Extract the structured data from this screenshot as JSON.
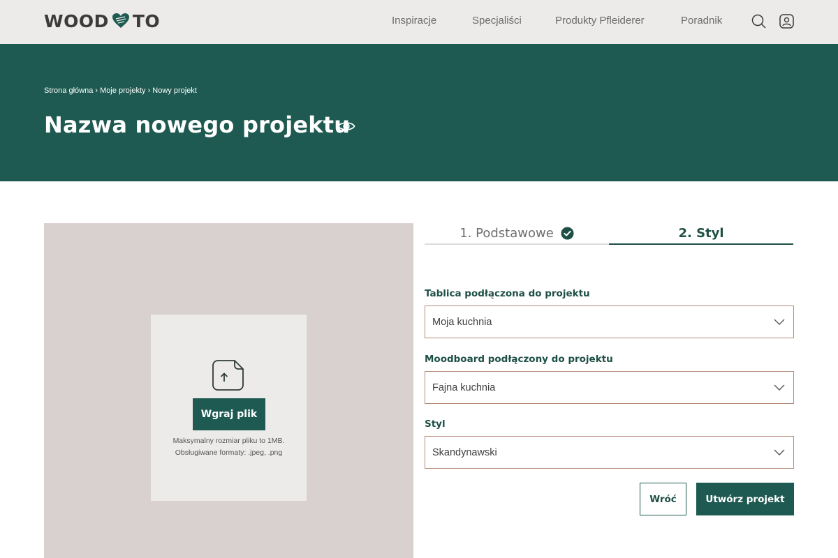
{
  "header": {
    "logo": {
      "left_text": "WOOD",
      "right_text": "TO",
      "heart_icon": "heart-leaf-icon"
    },
    "nav": [
      "Inspiracje",
      "Specjaliści",
      "Produkty Pfleiderer",
      "Poradnik"
    ],
    "icons": [
      "search-icon",
      "user-icon"
    ]
  },
  "hero": {
    "breadcrumb": "Strona główna › Moje projekty › Nowy projekt",
    "title": "Nazwa nowego projektu",
    "title_icon": "eye-icon"
  },
  "upload": {
    "icon": "file-upload-icon",
    "button_label": "Wgraj plik",
    "hint_line1": "Maksymalny rozmiar pliku to 1MB.",
    "hint_line2": "Obsługiwane formaty: .jpeg, .png"
  },
  "tabs": [
    {
      "label": "1. Podstawowe",
      "completed": true,
      "active": false
    },
    {
      "label": "2. Styl",
      "completed": false,
      "active": true
    }
  ],
  "form": {
    "fields": [
      {
        "label": "Tablica podłączona do projektu",
        "value": "Moja kuchnia"
      },
      {
        "label": "Moodboard podłączony do projektu",
        "value": "Fajna kuchnia"
      },
      {
        "label": "Styl",
        "value": "Skandynawski"
      }
    ],
    "back_label": "Wróć",
    "submit_label": "Utwórz projekt"
  },
  "colors": {
    "brand_green": "#1e5a51",
    "header_bg": "#edebe9",
    "upload_bg": "#d9d1cf",
    "field_border": "#b48a78"
  }
}
